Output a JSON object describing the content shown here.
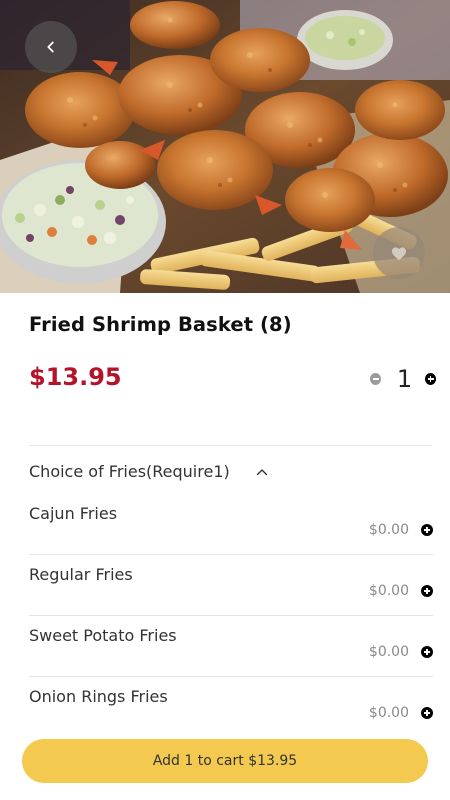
{
  "product": {
    "title": "Fried Shrimp Basket (8)",
    "price": "$13.95",
    "quantity": "1"
  },
  "hero": {
    "back_icon": "chevron-left-icon",
    "favorite_icon": "heart-icon"
  },
  "options_section": {
    "title": "Choice of Fries(Require1)",
    "toggle_icon": "chevron-up-icon",
    "items": [
      {
        "name": "Cajun Fries",
        "price": "$0.00"
      },
      {
        "name": "Regular Fries",
        "price": "$0.00"
      },
      {
        "name": "Sweet Potato Fries",
        "price": "$0.00"
      },
      {
        "name": "Onion Rings Fries",
        "price": "$0.00"
      }
    ]
  },
  "cart": {
    "label": "Add 1 to cart $13.95"
  },
  "colors": {
    "price_red": "#b5122b",
    "cart_button_yellow": "#f4c94f"
  }
}
